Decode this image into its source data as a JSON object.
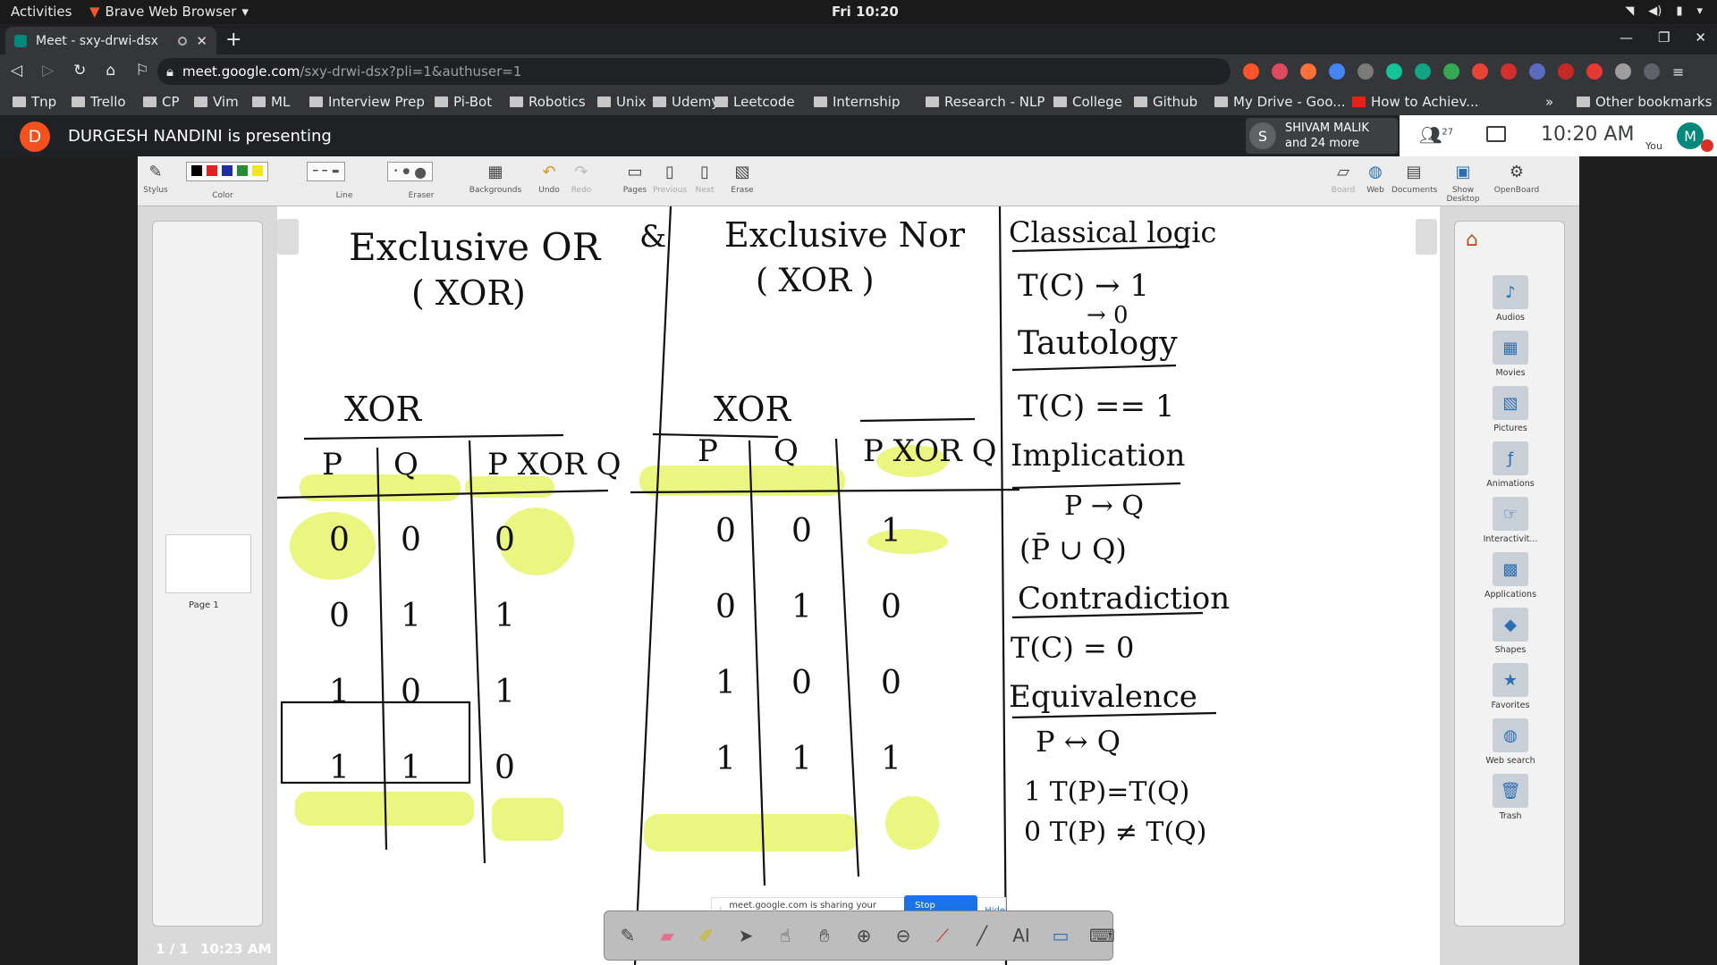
{
  "system": {
    "activities": "Activities",
    "app_name": "Brave Web Browser",
    "clock": "Fri 10:20"
  },
  "browser": {
    "tab_title": "Meet - sxy-drwi-dsx",
    "url_host": "meet.google.com",
    "url_path": "/sxy-drwi-dsx?pli=1&authuser=1",
    "bookmarks": [
      "Tnp",
      "Trello",
      "CP",
      "Vim",
      "ML",
      "Interview Prep",
      "Pi-Bot",
      "Robotics",
      "Unix",
      "Udemy",
      "Leetcode",
      "Internship",
      "Research - NLP",
      "College",
      "Github",
      "My Drive - Goo...",
      "How to Achiev..."
    ],
    "more_bookmarks": "»",
    "other_bookmarks": "Other bookmarks"
  },
  "meet": {
    "presenter_initial": "D",
    "presenting_text": "DURGESH NANDINI is presenting",
    "participant_initial": "S",
    "participant_name": "SHIVAM MALIK",
    "participant_more": "and 24 more",
    "participant_count": "27",
    "time": "10:20 AM",
    "you_initial": "M",
    "you_label": "You"
  },
  "openboard": {
    "tools": [
      {
        "label": "Stylus"
      },
      {
        "label": "Color"
      },
      {
        "label": "Line"
      },
      {
        "label": "Eraser"
      },
      {
        "label": "Backgrounds"
      },
      {
        "label": "Undo"
      },
      {
        "label": "Redo"
      },
      {
        "label": "Pages"
      },
      {
        "label": "Previous"
      },
      {
        "label": "Next"
      },
      {
        "label": "Erase"
      }
    ],
    "right_tools": [
      {
        "label": "Board"
      },
      {
        "label": "Web"
      },
      {
        "label": "Documents"
      },
      {
        "label": "Show Desktop"
      },
      {
        "label": "OpenBoard"
      }
    ],
    "colors": [
      "#000000",
      "#e81f1f",
      "#1c2f9e",
      "#1f8f2f",
      "#f5e51b"
    ],
    "page_label": "Page 1",
    "page_count": "1 / 1",
    "board_time": "10:23 AM",
    "library": [
      "Audios",
      "Movies",
      "Pictures",
      "Animations",
      "Interactivit...",
      "Applications",
      "Shapes",
      "Favorites",
      "Web search",
      "Trash"
    ]
  },
  "whiteboard": {
    "title_left": "Exclusive OR",
    "title_left_sub": "( XOR)",
    "ampersand": "&",
    "title_mid": "Exclusive Nor",
    "title_mid_sub": "( XOR )",
    "xor_heading": "XOR",
    "xnor_heading": "XOR",
    "xor_headers": [
      "P",
      "Q",
      "P XOR Q"
    ],
    "xor_rows": [
      [
        "0",
        "0",
        "0"
      ],
      [
        "0",
        "1",
        "1"
      ],
      [
        "1",
        "0",
        "1"
      ],
      [
        "1",
        "1",
        "0"
      ]
    ],
    "xnor_headers": [
      "P",
      "Q",
      "P XOR Q"
    ],
    "xnor_rows": [
      [
        "0",
        "0",
        "1"
      ],
      [
        "0",
        "1",
        "0"
      ],
      [
        "1",
        "0",
        "0"
      ],
      [
        "1",
        "1",
        "1"
      ]
    ],
    "notes": [
      "Classical logic",
      "T(C) → 1",
      "→ 0",
      "Tautology",
      "T(C) == 1",
      "Implication",
      "P → Q",
      "(P̄ ∪ Q)",
      "Contradiction",
      "T(C) = 0",
      "Equivalence",
      "P ↔ Q",
      "1  T(P)=T(Q)",
      "0  T(P) ≠ T(Q)"
    ]
  },
  "share": {
    "notice": "meet.google.com is sharing your screen.",
    "stop": "Stop sharing",
    "hide": "Hide"
  }
}
